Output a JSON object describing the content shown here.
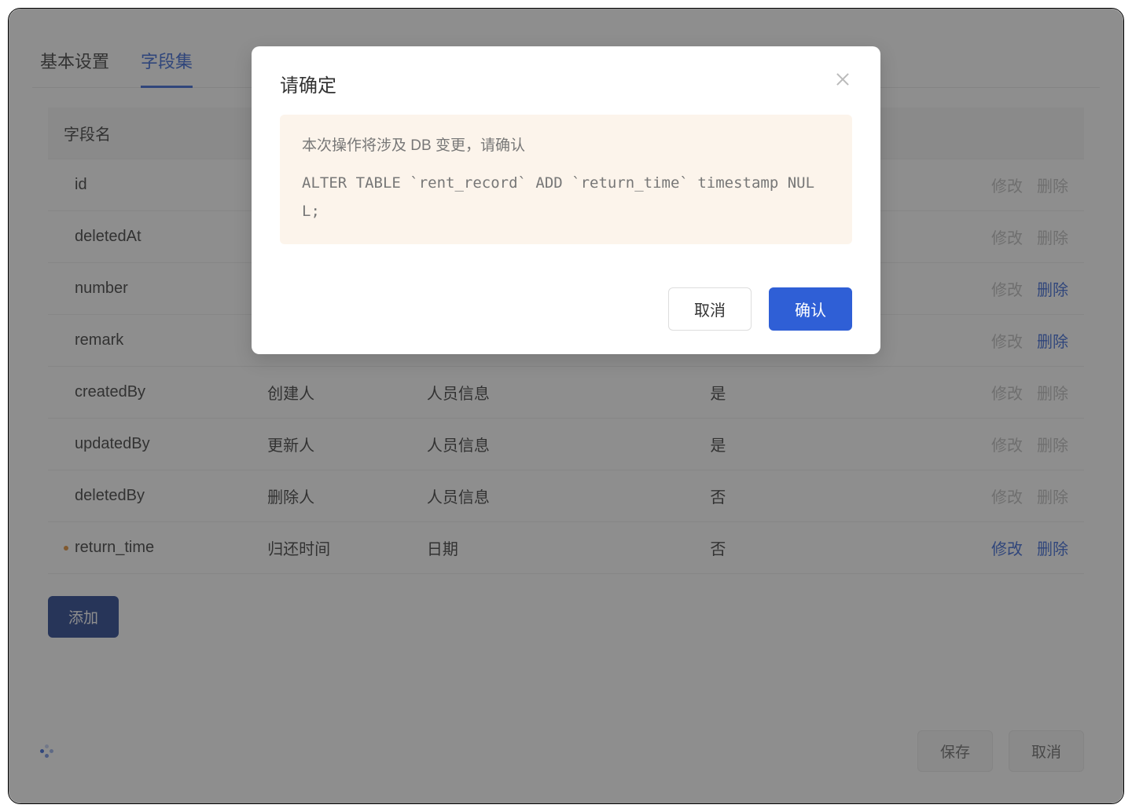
{
  "tabs": {
    "basic": "基本设置",
    "fields": "字段集"
  },
  "columns": {
    "field": "字段名",
    "label": "",
    "type": "",
    "system": "",
    "actions": ""
  },
  "rows": [
    {
      "field": "id",
      "label": "",
      "type": "",
      "system": "",
      "edit_enabled": false,
      "delete_enabled": false,
      "dirty": false
    },
    {
      "field": "deletedAt",
      "label": "",
      "type": "",
      "system": "",
      "edit_enabled": false,
      "delete_enabled": false,
      "dirty": false
    },
    {
      "field": "number",
      "label": "",
      "type": "",
      "system": "",
      "edit_enabled": false,
      "delete_enabled": true,
      "dirty": false
    },
    {
      "field": "remark",
      "label": "",
      "type": "",
      "system": "",
      "edit_enabled": false,
      "delete_enabled": true,
      "dirty": false
    },
    {
      "field": "createdBy",
      "label": "创建人",
      "type": "人员信息",
      "system": "是",
      "edit_enabled": false,
      "delete_enabled": false,
      "dirty": false
    },
    {
      "field": "updatedBy",
      "label": "更新人",
      "type": "人员信息",
      "system": "是",
      "edit_enabled": false,
      "delete_enabled": false,
      "dirty": false
    },
    {
      "field": "deletedBy",
      "label": "删除人",
      "type": "人员信息",
      "system": "否",
      "edit_enabled": false,
      "delete_enabled": false,
      "dirty": false
    },
    {
      "field": "return_time",
      "label": "归还时间",
      "type": "日期",
      "system": "否",
      "edit_enabled": true,
      "delete_enabled": true,
      "dirty": true
    }
  ],
  "action_labels": {
    "edit": "修改",
    "delete": "删除"
  },
  "buttons": {
    "add": "添加",
    "save": "保存",
    "cancel": "取消"
  },
  "modal": {
    "title": "请确定",
    "warn": "本次操作将涉及 DB 变更，请确认",
    "sql": "ALTER TABLE `rent_record` ADD `return_time` timestamp NULL;",
    "cancel": "取消",
    "confirm": "确认"
  }
}
